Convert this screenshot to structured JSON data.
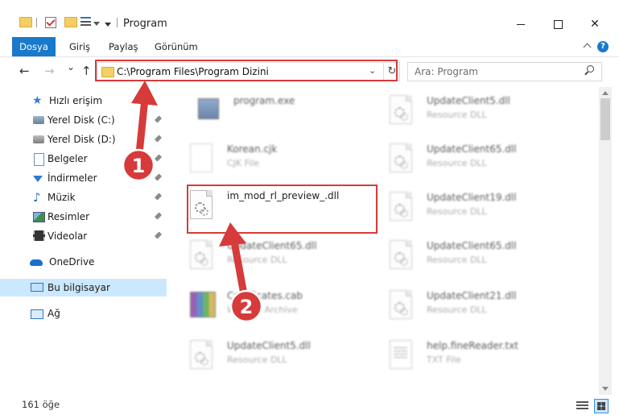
{
  "window": {
    "title": "Program",
    "controls": {
      "minimize": "",
      "maximize": "",
      "close": "✕"
    }
  },
  "ribbon": {
    "tabs": [
      {
        "label": "Dosya"
      },
      {
        "label": "Giriş"
      },
      {
        "label": "Paylaş"
      },
      {
        "label": "Görünüm"
      }
    ],
    "help": "?"
  },
  "nav": {
    "back": "←",
    "forward": "→",
    "recent": "⌄",
    "up": "↑",
    "address": "C:\\Program Files\\Program Dizini",
    "refresh": "↻",
    "dropdown": "⌄"
  },
  "search": {
    "placeholder": "Ara: Program"
  },
  "sidebar": {
    "quick_access": "Hızlı erişim",
    "items": [
      {
        "label": "Yerel Disk (C:)"
      },
      {
        "label": "Yerel Disk (D:)"
      },
      {
        "label": "Belgeler"
      },
      {
        "label": "İndirmeler"
      },
      {
        "label": "Müzik"
      },
      {
        "label": "Resimler"
      },
      {
        "label": "Videolar"
      }
    ],
    "onedrive": "OneDrive",
    "this_pc": "Bu bilgisayar",
    "network": "Ağ"
  },
  "files": {
    "left": [
      {
        "name": "program.exe",
        "type": ""
      },
      {
        "name": "Korean.cjk",
        "type": "CJK File"
      },
      {
        "name": "im_mod_rl_preview_.dll",
        "type": ""
      },
      {
        "name": "UpdateClient65.dll",
        "type": "Resource DLL"
      },
      {
        "name": "Certificates.cab",
        "type": "WinRAR Archive"
      },
      {
        "name": "UpdateClient5.dll",
        "type": "Resource DLL"
      }
    ],
    "right": [
      {
        "name": "UpdateClient5.dll",
        "type": "Resource DLL"
      },
      {
        "name": "UpdateClient65.dll",
        "type": "Resource DLL"
      },
      {
        "name": "UpdateClient19.dll",
        "type": "Resource DLL"
      },
      {
        "name": "UpdateClient65.dll",
        "type": "Resource DLL"
      },
      {
        "name": "UpdateClient21.dll",
        "type": "Resource DLL"
      },
      {
        "name": "help.fineReader.txt",
        "type": "TXT File"
      }
    ]
  },
  "annotations": {
    "step1": "1",
    "step2": "2",
    "color": "#d73a3a"
  },
  "status": {
    "count": "161 öğe"
  },
  "colors": {
    "accent": "#1979ca",
    "selected": "#cce8ff"
  }
}
